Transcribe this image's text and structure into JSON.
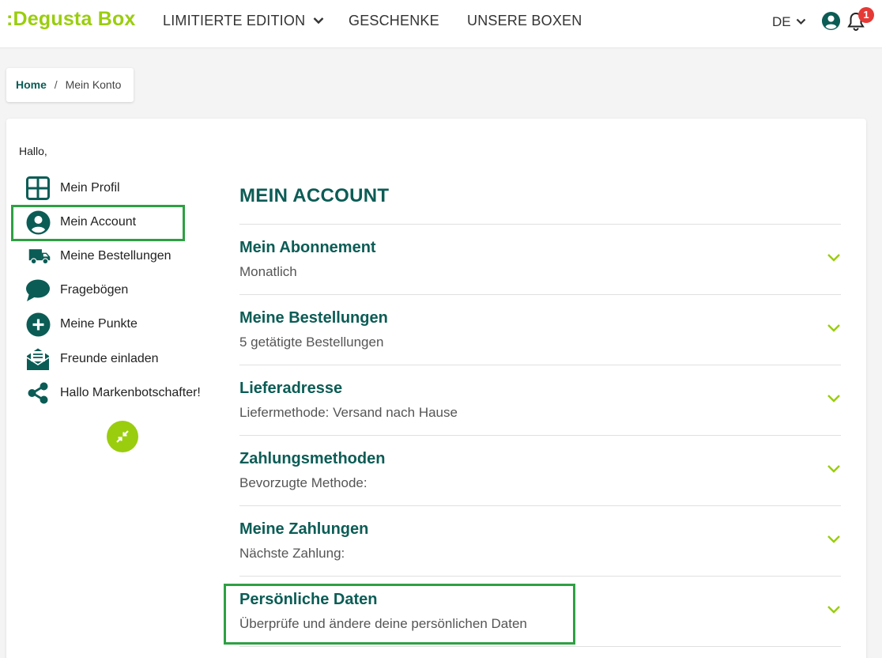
{
  "header": {
    "logo": ":Degusta Box",
    "nav": [
      {
        "label": "LIMITIERTE EDITION",
        "has_dropdown": true
      },
      {
        "label": "GESCHENKE",
        "has_dropdown": false
      },
      {
        "label": "UNSERE BOXEN",
        "has_dropdown": false
      }
    ],
    "language": "DE",
    "notification_count": "1"
  },
  "breadcrumb": {
    "home": "Home",
    "separator": "/",
    "current": "Mein Konto"
  },
  "greeting": "Hallo,",
  "sidebar": {
    "items": [
      {
        "label": "Mein Profil",
        "icon": "grid-icon",
        "active": false
      },
      {
        "label": "Mein Account",
        "icon": "user-circle-icon",
        "active": true
      },
      {
        "label": "Meine Bestellungen",
        "icon": "truck-icon",
        "active": false
      },
      {
        "label": "Fragebögen",
        "icon": "speech-bubble-icon",
        "active": false
      },
      {
        "label": "Meine Punkte",
        "icon": "plus-circle-icon",
        "active": false
      },
      {
        "label": "Freunde einladen",
        "icon": "envelope-icon",
        "active": false
      },
      {
        "label": "Hallo Markenbotschafter!",
        "icon": "share-icon",
        "active": false
      }
    ]
  },
  "main": {
    "title": "MEIN ACCOUNT",
    "sections": [
      {
        "title": "Mein Abonnement",
        "subtitle": "Monatlich"
      },
      {
        "title": "Meine Bestellungen",
        "subtitle": "5 getätigte Bestellungen"
      },
      {
        "title": "Lieferadresse",
        "subtitle": "Liefermethode: Versand nach Hause"
      },
      {
        "title": "Zahlungsmethoden",
        "subtitle": "Bevorzugte Methode:"
      },
      {
        "title": "Meine Zahlungen",
        "subtitle": "Nächste Zahlung:"
      },
      {
        "title": "Persönliche Daten",
        "subtitle": "Überprüfe und ändere deine persönlichen Daten"
      }
    ]
  },
  "colors": {
    "brand_green": "#9acd0e",
    "dark_teal": "#0b5c55",
    "highlight_green": "#2ea043",
    "badge_red": "#e53935"
  }
}
